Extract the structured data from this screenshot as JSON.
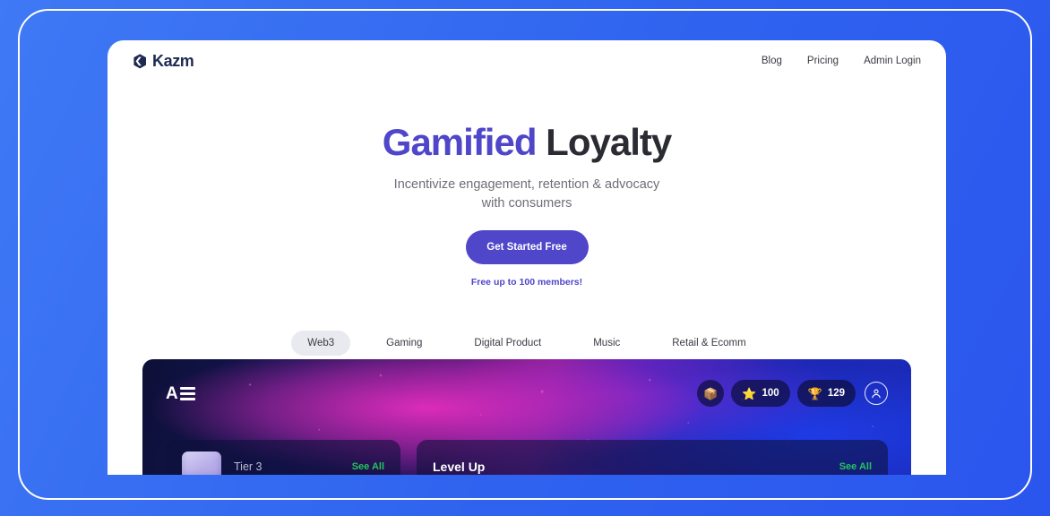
{
  "brand": {
    "name": "Kazm",
    "logo_icon": "kazm-hexagon-icon"
  },
  "nav": {
    "links": [
      {
        "label": "Blog"
      },
      {
        "label": "Pricing"
      },
      {
        "label": "Admin Login"
      }
    ]
  },
  "hero": {
    "title_accent": "Gamified",
    "title_rest": " Loyalty",
    "subtitle_line1": "Incentivize engagement, retention & advocacy",
    "subtitle_line2": "with consumers",
    "cta_label": "Get Started Free",
    "cta_note": "Free up to 100 members!",
    "accent_color": "#4f46c9"
  },
  "category_tabs": {
    "active": "Web3",
    "items": [
      {
        "label": "Web3"
      },
      {
        "label": "Gaming"
      },
      {
        "label": "Digital Product"
      },
      {
        "label": "Music"
      },
      {
        "label": "Retail & Ecomm"
      }
    ]
  },
  "preview": {
    "app_logo_letter": "A",
    "app_logo_icon": "menu-bars-icon",
    "chips": [
      {
        "icon": "mailbox-icon",
        "value": ""
      },
      {
        "icon": "star-icon",
        "value": "100"
      },
      {
        "icon": "trophy-icon",
        "value": "129"
      }
    ],
    "avatar_icon": "user-avatar-icon",
    "cards": [
      {
        "title": "Tier 3",
        "action_label": "See All",
        "thumbnail_icon": "tier-badge-thumbnail"
      },
      {
        "title": "Level Up",
        "action_label": "See All"
      }
    ],
    "action_color": "#22c55e"
  },
  "page_background_color": "#3b72f2"
}
